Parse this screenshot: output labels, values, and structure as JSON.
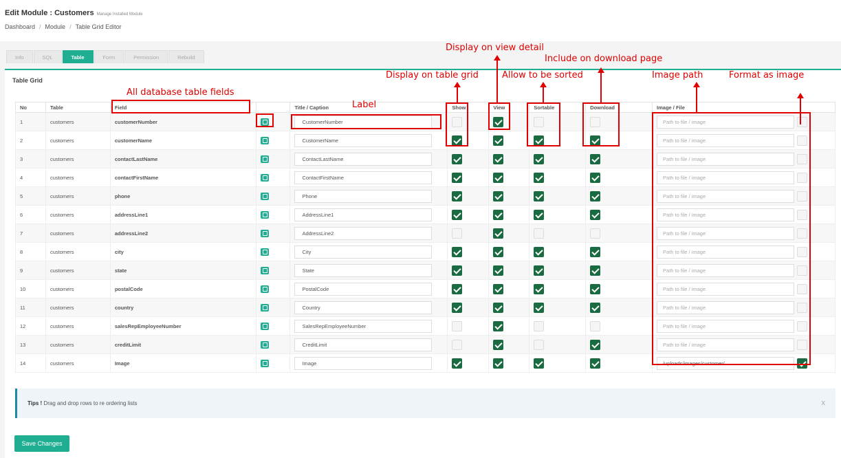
{
  "header": {
    "title": "Edit Module : Customers",
    "subtitle": "Manage Installed Module"
  },
  "breadcrumb": [
    "Dashboard",
    "Module",
    "Table Grid Editor"
  ],
  "tabs": [
    "Info",
    "SQL",
    "Table",
    "Form",
    "Permission",
    "Rebuild"
  ],
  "active_tab": "Table",
  "panel_title": "Table Grid",
  "columns": [
    "No",
    "Table",
    "Field",
    "",
    "Title / Caption",
    "Show",
    "View",
    "Sortable",
    "Download",
    "Image / File"
  ],
  "path_placeholder": "Path to file / image",
  "rows": [
    {
      "no": "1",
      "table": "customers",
      "field": "customerNumber",
      "caption": "CustomerNumber",
      "show": false,
      "view": true,
      "sortable": false,
      "download": false,
      "path": "",
      "format_image": false
    },
    {
      "no": "2",
      "table": "customers",
      "field": "customerName",
      "caption": "CustomerName",
      "show": true,
      "view": true,
      "sortable": true,
      "download": true,
      "path": "",
      "format_image": false
    },
    {
      "no": "3",
      "table": "customers",
      "field": "contactLastName",
      "caption": "ContactLastName",
      "show": true,
      "view": true,
      "sortable": true,
      "download": true,
      "path": "",
      "format_image": false
    },
    {
      "no": "4",
      "table": "customers",
      "field": "contactFirstName",
      "caption": "ContactFirstName",
      "show": true,
      "view": true,
      "sortable": true,
      "download": true,
      "path": "",
      "format_image": false
    },
    {
      "no": "5",
      "table": "customers",
      "field": "phone",
      "caption": "Phone",
      "show": true,
      "view": true,
      "sortable": true,
      "download": true,
      "path": "",
      "format_image": false
    },
    {
      "no": "6",
      "table": "customers",
      "field": "addressLine1",
      "caption": "AddressLine1",
      "show": true,
      "view": true,
      "sortable": true,
      "download": true,
      "path": "",
      "format_image": false
    },
    {
      "no": "7",
      "table": "customers",
      "field": "addressLine2",
      "caption": "AddressLine2",
      "show": false,
      "view": true,
      "sortable": false,
      "download": false,
      "path": "",
      "format_image": false
    },
    {
      "no": "8",
      "table": "customers",
      "field": "city",
      "caption": "City",
      "show": true,
      "view": true,
      "sortable": true,
      "download": true,
      "path": "",
      "format_image": false
    },
    {
      "no": "9",
      "table": "customers",
      "field": "state",
      "caption": "State",
      "show": true,
      "view": true,
      "sortable": true,
      "download": true,
      "path": "",
      "format_image": false
    },
    {
      "no": "10",
      "table": "customers",
      "field": "postalCode",
      "caption": "PostalCode",
      "show": true,
      "view": true,
      "sortable": true,
      "download": true,
      "path": "",
      "format_image": false
    },
    {
      "no": "11",
      "table": "customers",
      "field": "country",
      "caption": "Country",
      "show": true,
      "view": true,
      "sortable": true,
      "download": true,
      "path": "",
      "format_image": false
    },
    {
      "no": "12",
      "table": "customers",
      "field": "salesRepEmployeeNumber",
      "caption": "SalesRepEmployeeNumber",
      "show": false,
      "view": true,
      "sortable": false,
      "download": false,
      "path": "",
      "format_image": false
    },
    {
      "no": "13",
      "table": "customers",
      "field": "creditLimit",
      "caption": "CreditLimit",
      "show": false,
      "view": true,
      "sortable": false,
      "download": true,
      "path": "",
      "format_image": false
    },
    {
      "no": "14",
      "table": "customers",
      "field": "Image",
      "caption": "Image",
      "show": true,
      "view": true,
      "sortable": true,
      "download": true,
      "path": "/uploads/images/customer/",
      "format_image": true
    }
  ],
  "tips": {
    "label": "Tips !",
    "text": "Drag and drop rows to re ordering lists",
    "close": "x"
  },
  "save_label": "Save Changes",
  "annotations": {
    "display_on_view_detail": "Display on view detail",
    "include_on_download_page": "Include on download page",
    "display_on_table_grid": "Display on table grid",
    "allow_to_be_sorted": "Allow to be sorted",
    "image_path": "Image path",
    "format_as_image": "Format as image",
    "all_database_table_fields": "All database table fields",
    "label": "Label"
  },
  "colors": {
    "accent": "#1fae91",
    "checked": "#1a6b42",
    "annotation": "#e00000"
  }
}
